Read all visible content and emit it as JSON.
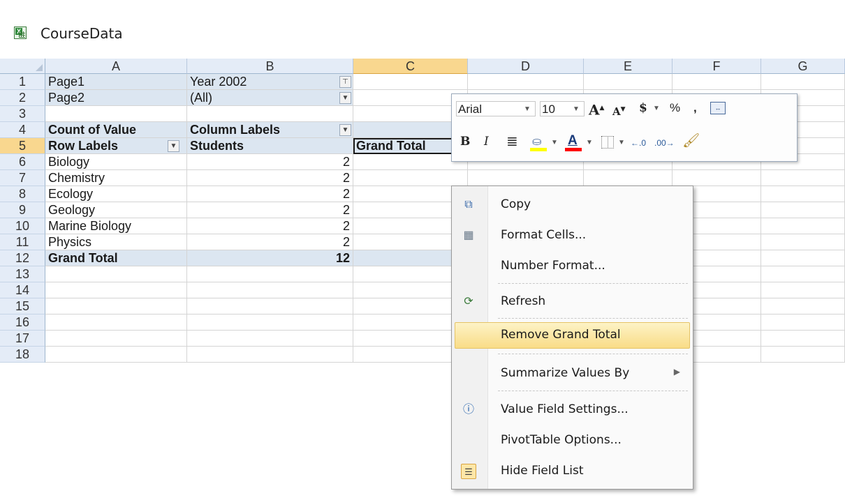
{
  "window": {
    "title": "CourseData"
  },
  "columns": [
    "A",
    "B",
    "C",
    "D",
    "E",
    "F",
    "G"
  ],
  "rows": [
    "1",
    "2",
    "3",
    "4",
    "5",
    "6",
    "7",
    "8",
    "9",
    "10",
    "11",
    "12",
    "13",
    "14",
    "15",
    "16",
    "17",
    "18"
  ],
  "pivot": {
    "page1_label": "Page1",
    "page1_value": "Year 2002",
    "page2_label": "Page2",
    "page2_value": "(All)",
    "value_header": "Count of Value",
    "column_labels": "Column Labels",
    "row_labels": "Row Labels",
    "column_item": "Students",
    "grand_total_col": "Grand Total",
    "grand_total_row": "Grand Total",
    "grand_total_value": "12",
    "grand_total_c": "1",
    "items": [
      {
        "label": "Biology",
        "value": "2"
      },
      {
        "label": "Chemistry",
        "value": "2"
      },
      {
        "label": "Ecology",
        "value": "2"
      },
      {
        "label": "Geology",
        "value": "2"
      },
      {
        "label": "Marine Biology",
        "value": "2"
      },
      {
        "label": "Physics",
        "value": "2"
      }
    ]
  },
  "mini_toolbar": {
    "font_name": "Arial",
    "font_size": "10",
    "currency": "$",
    "percent": "%",
    "comma": ",",
    "bold": "B",
    "italic": "I",
    "font_color_letter": "A",
    "grow_letter": "A",
    "shrink_letter": "A",
    "fill_color": "#ffff00",
    "font_color": "#ff0000"
  },
  "context_menu": {
    "copy": "Copy",
    "format_cells": "Format Cells...",
    "number_format": "Number Format...",
    "refresh": "Refresh",
    "remove_grand_total": "Remove Grand Total",
    "summarize_values_by": "Summarize Values By",
    "value_field_settings": "Value Field Settings...",
    "pivottable_options": "PivotTable Options...",
    "hide_field_list": "Hide Field List"
  }
}
